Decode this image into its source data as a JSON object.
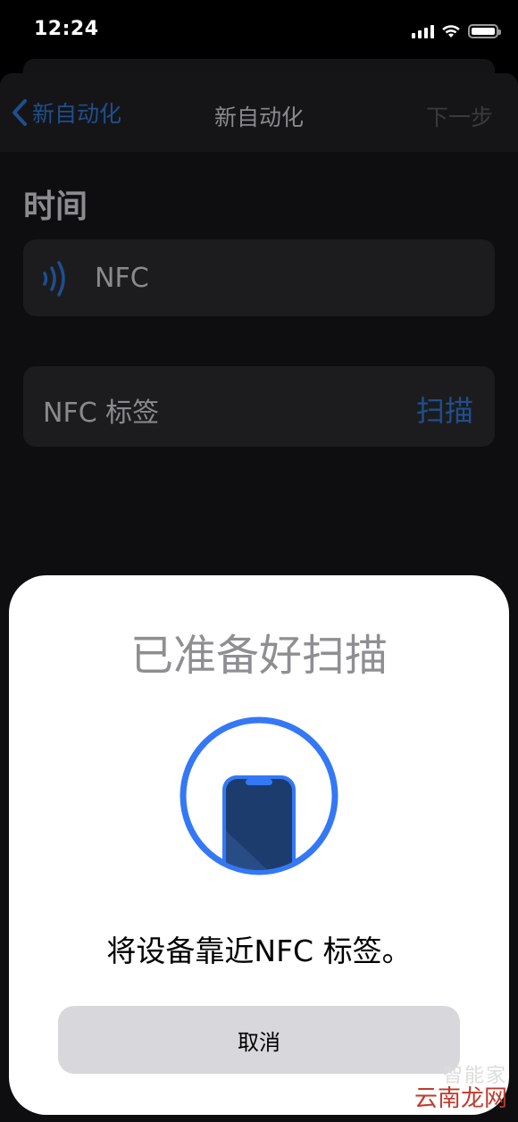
{
  "status_bar": {
    "time": "12:24",
    "icons": [
      "cellular-signal-icon",
      "wifi-icon",
      "battery-icon"
    ]
  },
  "nav": {
    "back_label": "新自动化",
    "title": "新自动化",
    "next_label": "下一步"
  },
  "section": {
    "title": "时间"
  },
  "trigger": {
    "label": "NFC",
    "icon": "nfc-icon"
  },
  "tag_row": {
    "label": "NFC 标签",
    "action": "扫描"
  },
  "scan_sheet": {
    "title": "已准备好扫描",
    "message": "将设备靠近NFC 标签。",
    "cancel_label": "取消",
    "graphic": "phone-in-circle-icon"
  },
  "watermark": {
    "faint": "智能家",
    "main": "云南龙网"
  },
  "colors": {
    "accent": "#3478F6",
    "dim_accent": "#1E4F8F",
    "sheet_bg": "#FFFFFF",
    "cancel_bg": "#D8D8DC",
    "watermark": "#C0392B"
  }
}
